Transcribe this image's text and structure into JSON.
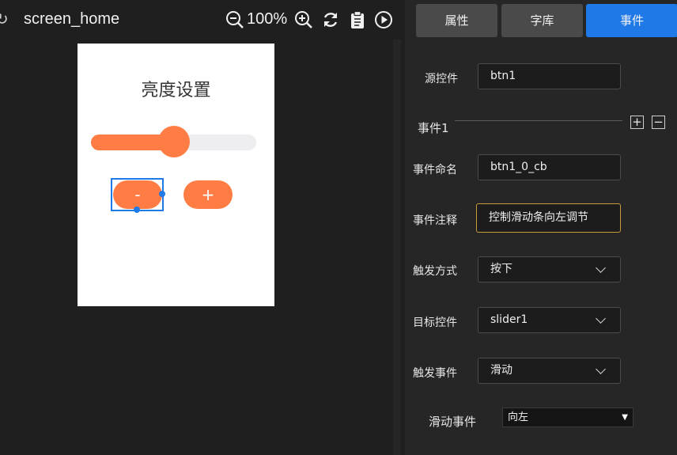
{
  "toolbar": {
    "screen_name": "screen_home",
    "zoom": "100%",
    "icons": [
      "refresh-icon",
      "zoom-out-icon",
      "zoom-in-icon",
      "sync-icon",
      "clipboard-icon",
      "play-icon"
    ]
  },
  "canvas": {
    "title": "亮度设置",
    "slider_level": 0.5,
    "btn_minus_label": "-",
    "btn_plus_label": "+",
    "accent_color": "#ff7d45",
    "selection_color": "#1f7ae8"
  },
  "panel": {
    "tabs": [
      {
        "label": "属性",
        "active": false
      },
      {
        "label": "字库",
        "active": false
      },
      {
        "label": "事件",
        "active": true
      }
    ],
    "source_label": "源控件",
    "source_value": "btn1",
    "event_section": "事件1",
    "add_label": "+",
    "remove_label": "−",
    "name_label": "事件命名",
    "name_value": "btn1_0_cb",
    "comment_label": "事件注释",
    "comment_value": "控制滑动条向左调节",
    "trigger_label": "触发方式",
    "trigger_value": "按下",
    "target_label": "目标控件",
    "target_value": "slider1",
    "event_label": "触发事件",
    "event_value": "滑动",
    "slide_label": "滑动事件",
    "slide_value": "向左",
    "active_tab_color": "#1f7ae8"
  }
}
